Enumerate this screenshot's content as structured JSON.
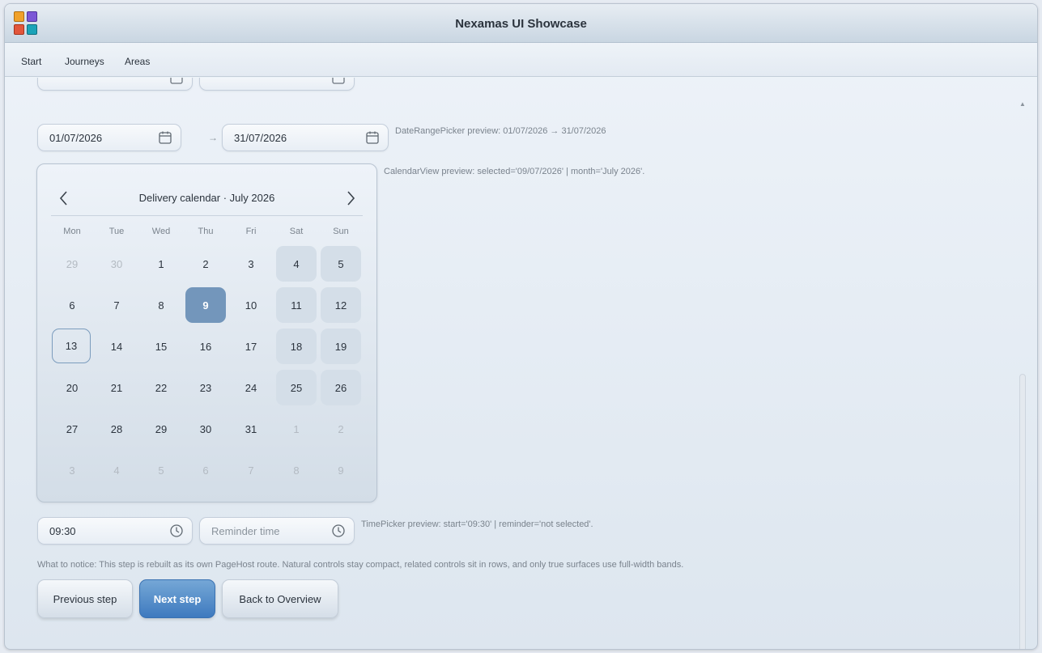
{
  "app": {
    "title": "Nexamas UI Showcase",
    "logo_colors": [
      "#f0a12a",
      "#7b57d6",
      "#e2563b",
      "#1ba3b8"
    ]
  },
  "menu": {
    "items": [
      "Start",
      "Journeys",
      "Areas"
    ]
  },
  "date_range": {
    "start": "01/07/2026",
    "end": "31/07/2026",
    "arrow": "→",
    "preview": "DateRangePicker preview: 01/07/2026 → 31/07/2026"
  },
  "calendar": {
    "title": "Delivery calendar · July 2026",
    "weekdays": [
      "Mon",
      "Tue",
      "Wed",
      "Thu",
      "Fri",
      "Sat",
      "Sun"
    ],
    "weeks": [
      [
        "29",
        "30",
        "1",
        "2",
        "3",
        "4",
        "5"
      ],
      [
        "6",
        "7",
        "8",
        "9",
        "10",
        "11",
        "12"
      ],
      [
        "13",
        "14",
        "15",
        "16",
        "17",
        "18",
        "19"
      ],
      [
        "20",
        "21",
        "22",
        "23",
        "24",
        "25",
        "26"
      ],
      [
        "27",
        "28",
        "29",
        "30",
        "31",
        "1",
        "2"
      ],
      [
        "3",
        "4",
        "5",
        "6",
        "7",
        "8",
        "9"
      ]
    ],
    "selected_day": "9",
    "today_day": "13",
    "preview": "CalendarView preview: selected='09/07/2026' | month='July 2026'."
  },
  "time": {
    "start_value": "09:30",
    "reminder_placeholder": "Reminder time",
    "preview": "TimePicker preview: start='09:30' | reminder='not selected'."
  },
  "notice": "What to notice: This step is rebuilt as its own PageHost route. Natural controls stay compact, related controls sit in rows, and only true surfaces use full-width bands.",
  "buttons": {
    "previous": "Previous step",
    "next": "Next step",
    "back": "Back to Overview"
  },
  "colors": {
    "accent": "#3e7abf",
    "selected_day": "#7396bb",
    "weekend_bg": "#d4dee8"
  }
}
